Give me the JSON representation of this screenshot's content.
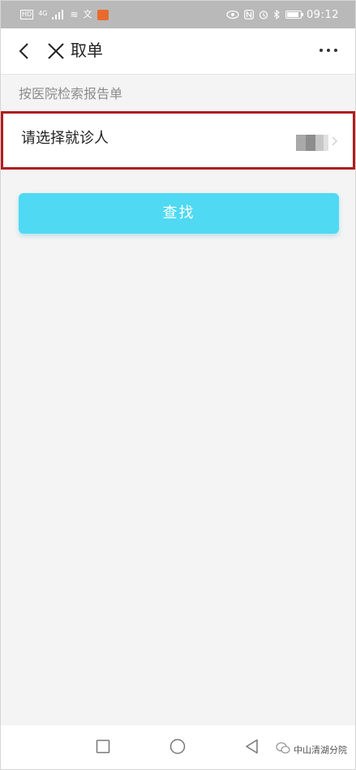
{
  "status_bar": {
    "network_type": "4G",
    "time": "09:12",
    "icons": [
      "hd-icon",
      "signal-icon",
      "wifi-icon",
      "app-icon",
      "eye-icon",
      "nfc-icon",
      "alarm-icon",
      "bluetooth-icon",
      "battery-icon"
    ]
  },
  "nav": {
    "title": "取单",
    "back_icon": "back-chevron-icon",
    "close_icon": "close-icon",
    "more_icon": "more-dots-icon"
  },
  "section": {
    "label": "按医院检索报告单"
  },
  "select_patient": {
    "label": "请选择就诊人",
    "arrow_icon": "chevron-right-icon"
  },
  "search_button": {
    "label": "查找"
  },
  "system_nav": {
    "icons": [
      "recent-apps-square-icon",
      "home-circle-icon",
      "back-triangle-icon"
    ]
  },
  "watermark": {
    "text": "中山清湖分院"
  },
  "colors": {
    "status_bar": "#b9b9b9",
    "highlight_border": "#b11d1d",
    "button": "#4fd9f3",
    "background": "#f4f4f4"
  }
}
